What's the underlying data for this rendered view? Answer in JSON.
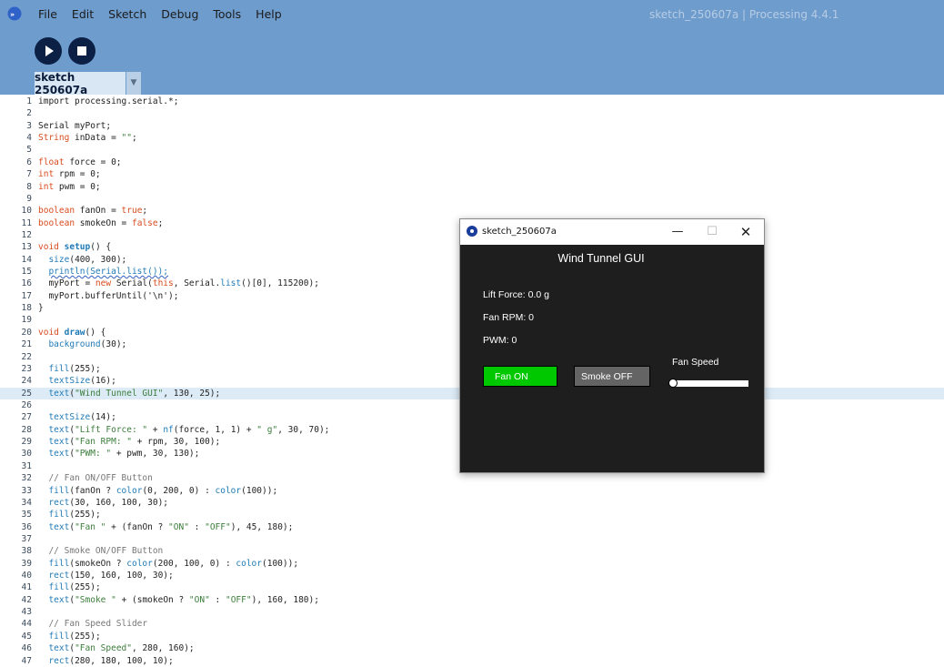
{
  "window": {
    "title": "sketch_250607a | Processing 4.4.1"
  },
  "menu": [
    "File",
    "Edit",
    "Sketch",
    "Debug",
    "Tools",
    "Help"
  ],
  "toolbar": {
    "run": "run",
    "stop": "stop"
  },
  "tab": {
    "label": "sketch 250607a",
    "menu_glyph": "▼"
  },
  "editor": {
    "highlighted_line": 25,
    "lines": [
      "1",
      "2",
      "3",
      "4",
      "5",
      "6",
      "7",
      "8",
      "9",
      "10",
      "11",
      "12",
      "13",
      "14",
      "15",
      "16",
      "17",
      "18",
      "19",
      "20",
      "21",
      "22",
      "23",
      "24",
      "25",
      "26",
      "27",
      "28",
      "29",
      "30",
      "31",
      "32",
      "33",
      "34",
      "35",
      "36",
      "37",
      "38",
      "39",
      "40",
      "41",
      "42",
      "43",
      "44",
      "45",
      "46",
      "47"
    ]
  },
  "sketch_window": {
    "title": "sketch_250607a",
    "minimize": "—",
    "maximize": "☐",
    "close": "✕",
    "canvas": {
      "heading": "Wind Tunnel GUI",
      "lift_force": "Lift Force: 0.0 g",
      "fan_rpm": "Fan RPM: 0",
      "pwm": "PWM: 0",
      "fan_button": "Fan ON",
      "smoke_button": "Smoke OFF",
      "fan_speed_label": "Fan Speed",
      "fan_speed_value": 0,
      "colors": {
        "background": "#1e1e1e",
        "fan_on": "#00c800",
        "smoke_off": "#646464"
      }
    }
  },
  "code": {
    "l1": "import processing.serial.*;",
    "l3": "Serial myPort;",
    "l4a": "String",
    "l4b": " inData = ",
    "l4c": "\"\"",
    "l4d": ";",
    "l6a": "float",
    "l6b": " force = 0;",
    "l7a": "int",
    "l7b": " rpm = 0;",
    "l8a": "int",
    "l8b": " pwm = 0;",
    "l10a": "boolean",
    "l10b": " fanOn = ",
    "l10c": "true",
    "l10d": ";",
    "l11a": "boolean",
    "l11b": " smokeOn = ",
    "l11c": "false",
    "l11d": ";",
    "l13a": "void",
    "l13b": " ",
    "l13c": "setup",
    "l13d": "() {",
    "l14a": "  ",
    "l14b": "size",
    "l14c": "(400, 300);",
    "l15a": "  ",
    "l15b": "println(Serial.list());",
    "l16a": "  myPort = ",
    "l16b": "new",
    "l16c": " Serial(",
    "l16d": "this",
    "l16e": ", Serial.",
    "l16f": "list",
    "l16g": "()[0], 115200);",
    "l17": "  myPort.bufferUntil('\\n');",
    "l18": "}",
    "l20a": "void",
    "l20b": " ",
    "l20c": "draw",
    "l20d": "() {",
    "l21a": "  ",
    "l21b": "background",
    "l21c": "(30);",
    "l23a": "  ",
    "l23b": "fill",
    "l23c": "(255);",
    "l24a": "  ",
    "l24b": "textSize",
    "l24c": "(16);",
    "l25a": "  ",
    "l25b": "text",
    "l25c": "(",
    "l25d": "\"Wind Tunnel GUI\"",
    "l25e": ", 130, 25);",
    "l27a": "  ",
    "l27b": "textSize",
    "l27c": "(14);",
    "l28a": "  ",
    "l28b": "text",
    "l28c": "(",
    "l28d": "\"Lift Force: \"",
    "l28e": " + ",
    "l28f": "nf",
    "l28g": "(force, 1, 1) + ",
    "l28h": "\" g\"",
    "l28i": ", 30, 70);",
    "l29a": "  ",
    "l29b": "text",
    "l29c": "(",
    "l29d": "\"Fan RPM: \"",
    "l29e": " + rpm, 30, 100);",
    "l30a": "  ",
    "l30b": "text",
    "l30c": "(",
    "l30d": "\"PWM: \"",
    "l30e": " + pwm, 30, 130);",
    "l32": "  // Fan ON/OFF Button",
    "l33a": "  ",
    "l33b": "fill",
    "l33c": "(fanOn ? ",
    "l33d": "color",
    "l33e": "(0, 200, 0) : ",
    "l33f": "color",
    "l33g": "(100));",
    "l34a": "  ",
    "l34b": "rect",
    "l34c": "(30, 160, 100, 30);",
    "l35a": "  ",
    "l35b": "fill",
    "l35c": "(255);",
    "l36a": "  ",
    "l36b": "text",
    "l36c": "(",
    "l36d": "\"Fan \"",
    "l36e": " + (fanOn ? ",
    "l36f": "\"ON\"",
    "l36g": " : ",
    "l36h": "\"OFF\"",
    "l36i": "), 45, 180);",
    "l38": "  // Smoke ON/OFF Button",
    "l39a": "  ",
    "l39b": "fill",
    "l39c": "(smokeOn ? ",
    "l39d": "color",
    "l39e": "(200, 100, 0) : ",
    "l39f": "color",
    "l39g": "(100));",
    "l40a": "  ",
    "l40b": "rect",
    "l40c": "(150, 160, 100, 30);",
    "l41a": "  ",
    "l41b": "fill",
    "l41c": "(255);",
    "l42a": "  ",
    "l42b": "text",
    "l42c": "(",
    "l42d": "\"Smoke \"",
    "l42e": " + (smokeOn ? ",
    "l42f": "\"ON\"",
    "l42g": " : ",
    "l42h": "\"OFF\"",
    "l42i": "), 160, 180);",
    "l44": "  // Fan Speed Slider",
    "l45a": "  ",
    "l45b": "fill",
    "l45c": "(255);",
    "l46a": "  ",
    "l46b": "text",
    "l46c": "(",
    "l46d": "\"Fan Speed\"",
    "l46e": ", 280, 160);",
    "l47a": "  ",
    "l47b": "rect",
    "l47c": "(280, 180, 100, 10);"
  }
}
